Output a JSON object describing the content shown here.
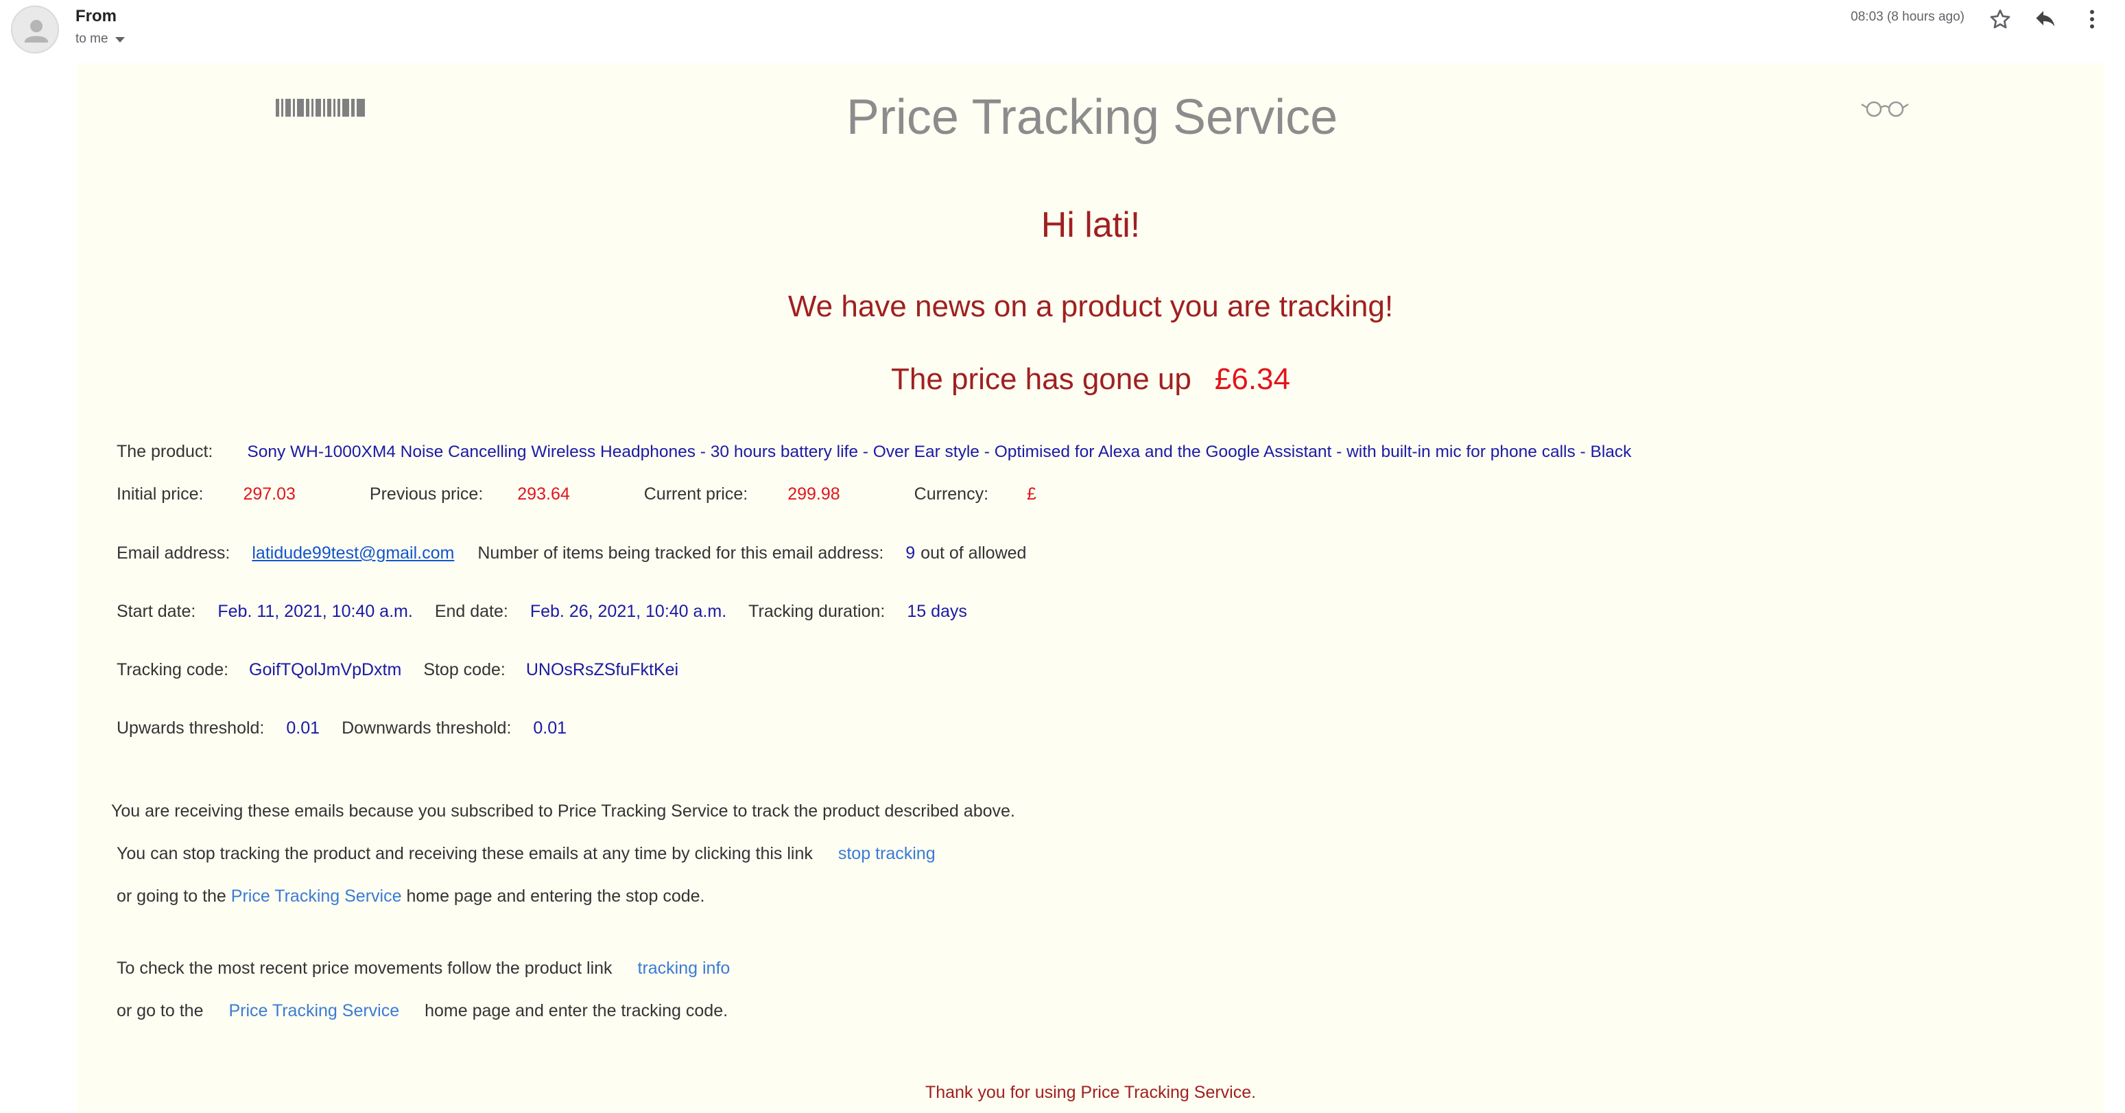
{
  "header": {
    "from_label": "From",
    "to_label": "to me",
    "time": "08:03 (8 hours ago)"
  },
  "email": {
    "brand": "Price Tracking Service",
    "greeting": "Hi lati!",
    "news": "We have news on a product you are tracking!",
    "price_change_text": "The price has gone up",
    "price_change_amount": "£6.34",
    "product_label": "The product:",
    "product_name": "Sony WH-1000XM4 Noise Cancelling Wireless Headphones - 30 hours battery life - Over Ear style - Optimised for Alexa and the Google Assistant - with built-in mic for phone calls - Black",
    "initial_price_label": "Initial price:",
    "initial_price": "297.03",
    "previous_price_label": "Previous price:",
    "previous_price": "293.64",
    "current_price_label": "Current price:",
    "current_price": "299.98",
    "currency_label": "Currency:",
    "currency": "£",
    "email_label": "Email address:",
    "email_value": "latidude99test@gmail.com",
    "items_label": "Number of items being tracked for this email address:",
    "items_count": "9",
    "items_suffix": "out of allowed",
    "start_label": "Start date:",
    "start_value": "Feb. 11, 2021, 10:40 a.m.",
    "end_label": "End date:",
    "end_value": "Feb. 26, 2021, 10:40 a.m.",
    "duration_label": "Tracking duration:",
    "duration_value": "15 days",
    "tracking_code_label": "Tracking code:",
    "tracking_code": "GoifTQolJmVpDxtm",
    "stop_code_label": "Stop code:",
    "stop_code": "UNOsRsZSfuFktKei",
    "up_threshold_label": "Upwards threshold:",
    "up_threshold": "0.01",
    "down_threshold_label": "Downwards threshold:",
    "down_threshold": "0.01",
    "receiving_text": "You are receiving these emails because you subscribed to Price Tracking Service to track the product described above.",
    "stop_text": "You can stop tracking the product and receiving these emails at any time by clicking this link",
    "stop_link": "stop tracking",
    "or_going_prefix": "or going to the",
    "brand_link": "Price Tracking Service",
    "or_going_suffix": "home page and entering the stop code.",
    "check_text": "To check the most recent price movements follow the product link",
    "tracking_link": "tracking info",
    "or_go_prefix": "or go to the",
    "or_go_suffix": "home page and enter the tracking code.",
    "thanks": "Thank you for using Price Tracking Service."
  }
}
